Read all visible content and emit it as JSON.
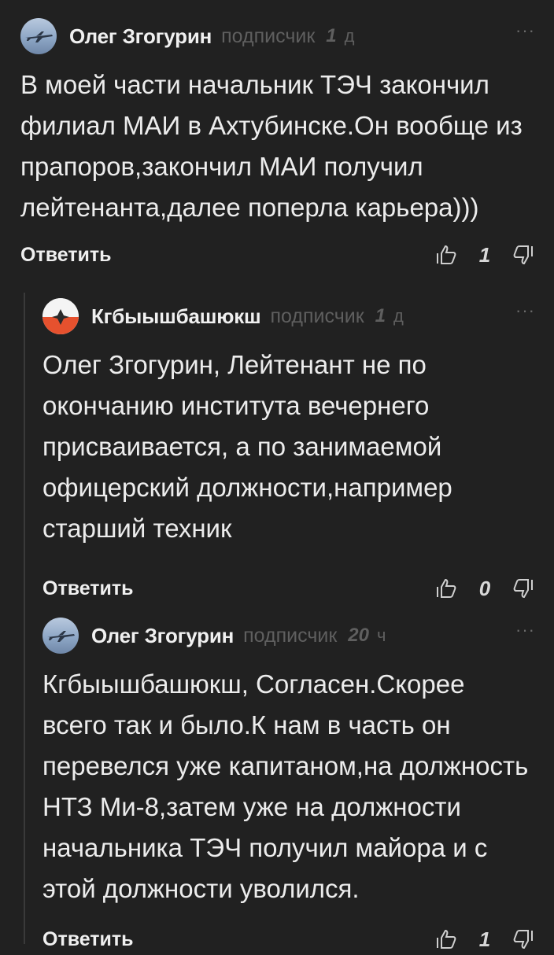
{
  "comments": [
    {
      "author": "Олег Згогурин",
      "role": "подписчик",
      "age_number": "1",
      "age_unit": "д",
      "more": "···",
      "text": "В моей части начальник ТЭЧ закончил филиал МАИ в Ахтубинске.Он вообще из прапоров,закончил МАИ получил лейтенанта,далее поперла карьера)))",
      "reply_label": "Ответить",
      "votes": "1",
      "avatar_icon": "airplane-avatar"
    },
    {
      "author": "Кгбыышбашюкш",
      "role": "подписчик",
      "age_number": "1",
      "age_unit": "д",
      "more": "···",
      "text": "Олег Згогурин, Лейтенант не по окончанию института вечернего присваивается, а по занимаемой офицерский должности,например старший техник",
      "reply_label": "Ответить",
      "votes": "0",
      "avatar_icon": "fox-avatar"
    },
    {
      "author": "Олег Згогурин",
      "role": "подписчик",
      "age_number": "20",
      "age_unit": "ч",
      "more": "···",
      "text": "Кгбыышбашюкш, Согласен.Скорее всего так и было.К нам в часть он перевелся уже капитаном,на должность НТЗ Ми-8,затем уже на должности начальника ТЭЧ получил майора и с этой должности уволился.",
      "reply_label": "Ответить",
      "votes": "1",
      "avatar_icon": "airplane-avatar"
    }
  ],
  "colors": {
    "background": "#212121",
    "text": "#ececec",
    "muted": "#5f5f5f",
    "thread_line": "#3a3a3a"
  }
}
